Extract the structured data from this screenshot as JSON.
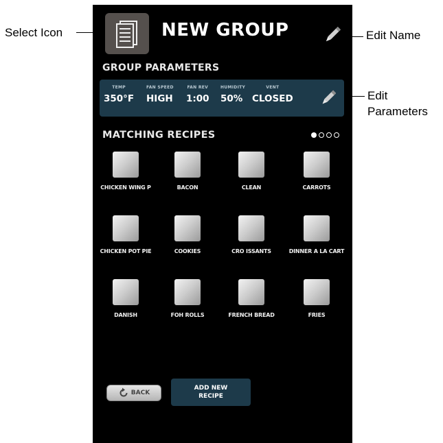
{
  "annotations": {
    "select_icon": "Select Icon",
    "edit_name": "Edit Name",
    "edit_parameters_line1": "Edit",
    "edit_parameters_line2": "Parameters"
  },
  "header": {
    "title": "NEW GROUP",
    "select_icon": "document-icon",
    "edit_name_icon": "pencil-icon"
  },
  "group_parameters": {
    "heading": "GROUP PARAMETERS",
    "edit_icon": "pencil-icon",
    "items": [
      {
        "label": "TEMP",
        "value": "350°F"
      },
      {
        "label": "FAN SPEED",
        "value": "HIGH"
      },
      {
        "label": "FAN REV",
        "value": "1:00"
      },
      {
        "label": "HUMIDITY",
        "value": "50%"
      },
      {
        "label": "VENT",
        "value": "CLOSED"
      }
    ]
  },
  "matching_recipes": {
    "heading": "MATCHING RECIPES",
    "pagination": {
      "current_page": 1,
      "total_pages": 4
    },
    "recipes": [
      {
        "name": "CHICKEN WING P"
      },
      {
        "name": "BACON"
      },
      {
        "name": "CLEAN"
      },
      {
        "name": "CARROTS"
      },
      {
        "name": "CHICKEN POT PIE"
      },
      {
        "name": "COOKIES"
      },
      {
        "name": "CRO ISSANTS"
      },
      {
        "name": "DINNER A LA CART"
      },
      {
        "name": "DANISH"
      },
      {
        "name": "FOH ROLLS"
      },
      {
        "name": "FRENCH BREAD"
      },
      {
        "name": "FRIES"
      }
    ]
  },
  "footer": {
    "back_label": "BACK",
    "add_recipe_line1": "ADD NEW",
    "add_recipe_line2": "RECIPE"
  },
  "colors": {
    "screen_background": "#000000",
    "panel_accent": "#1d3a4a",
    "icon_box": "#55504d",
    "text": "#ffffff"
  }
}
